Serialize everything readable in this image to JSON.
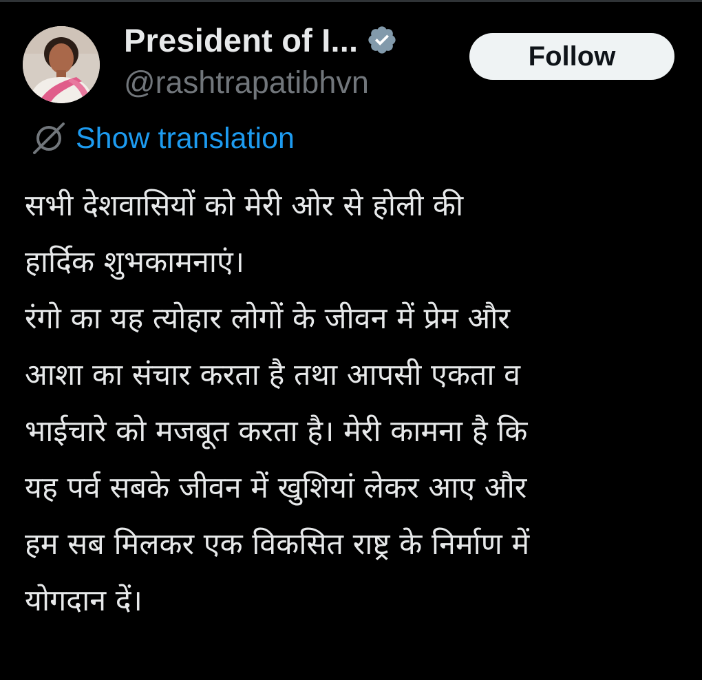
{
  "colors": {
    "background": "#000000",
    "text_primary": "#e7e9ea",
    "text_secondary": "#71767b",
    "link_blue": "#1d9bf0",
    "follow_bg": "#eff3f4",
    "follow_text": "#0f1419",
    "verified_badge": "#829aab"
  },
  "author": {
    "display_name": "President of I...",
    "handle": "@rashtrapatibhvn",
    "verified": true,
    "avatar_icon": "profile-photo"
  },
  "actions": {
    "follow_label": "Follow"
  },
  "translation": {
    "icon": "translate-icon",
    "label": "Show translation"
  },
  "tweet": {
    "lines": [
      "सभी देशवासियों को मेरी ओर से होली की",
      "हार्दिक शुभकामनाएं।",
      "रंगो का यह त्योहार लोगों के जीवन में प्रेम और",
      "आशा का संचार करता है तथा आपसी एकता व",
      "भाईचारे को मजबूत करता है।  मेरी कामना है कि",
      "यह पर्व सबके जीवन में खुशियां लेकर आए और",
      "हम सब मिलकर एक विकसित राष्ट्र के निर्माण में",
      "योगदान दें।"
    ]
  }
}
